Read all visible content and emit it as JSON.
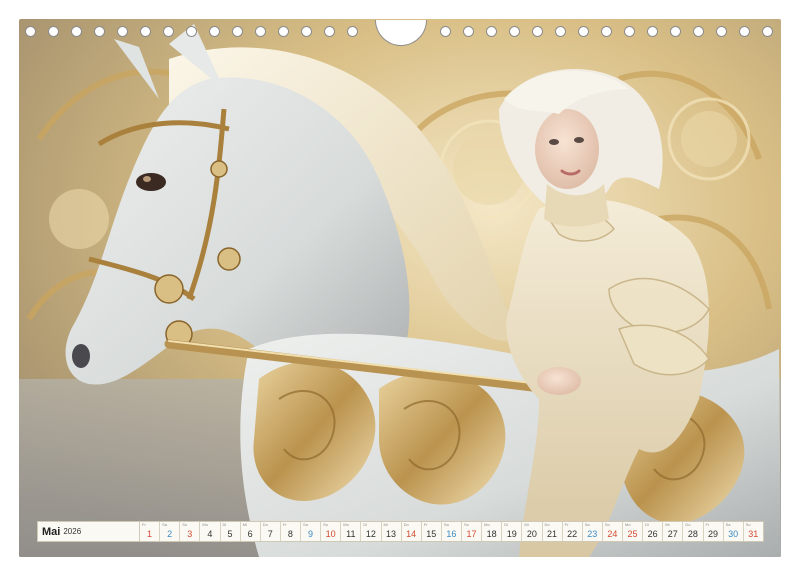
{
  "calendar": {
    "month": "Mai",
    "year": "2026",
    "weekday_labels": [
      "Fr",
      "Sa",
      "So",
      "Mo",
      "Di",
      "Mi",
      "Do",
      "Fr",
      "Sa",
      "So",
      "Mo",
      "Di",
      "Mi",
      "Do",
      "Fr",
      "Sa",
      "So",
      "Mo",
      "Di",
      "Mi",
      "Do",
      "Fr",
      "Sa",
      "So",
      "Mo",
      "Di",
      "Mi",
      "Do",
      "Fr",
      "Sa",
      "So"
    ],
    "days": [
      "1",
      "2",
      "3",
      "4",
      "5",
      "6",
      "7",
      "8",
      "9",
      "10",
      "11",
      "12",
      "13",
      "14",
      "15",
      "16",
      "17",
      "18",
      "19",
      "20",
      "21",
      "22",
      "23",
      "24",
      "25",
      "26",
      "27",
      "28",
      "29",
      "30",
      "31"
    ],
    "holidays": [
      "1",
      "14",
      "24",
      "25"
    ],
    "colors": {
      "sunday": "#d24a32",
      "saturday": "#3a8ac2",
      "weekday": "#333333"
    }
  },
  "photo": {
    "subject": "child with white hair riding an ornate white carousel horse"
  }
}
